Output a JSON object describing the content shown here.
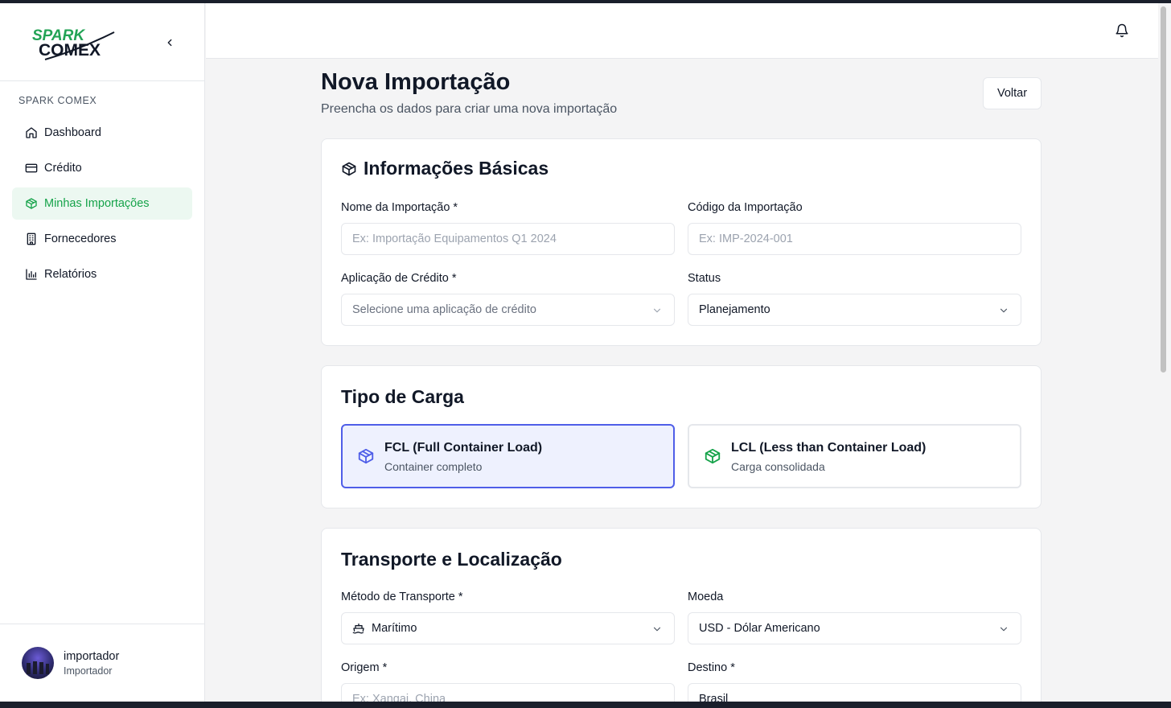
{
  "brand": {
    "logo_top": "SPARK",
    "logo_bottom": "COMEX",
    "accent": "#16a34a"
  },
  "sidebar": {
    "section_label": "SPARK COMEX",
    "items": [
      {
        "label": "Dashboard",
        "icon": "home-icon",
        "active": false
      },
      {
        "label": "Crédito",
        "icon": "credit-card-icon",
        "active": false
      },
      {
        "label": "Minhas Importações",
        "icon": "package-icon",
        "active": true
      },
      {
        "label": "Fornecedores",
        "icon": "building-icon",
        "active": false
      },
      {
        "label": "Relatórios",
        "icon": "bar-chart-icon",
        "active": false
      }
    ],
    "user": {
      "name": "importador",
      "role": "Importador"
    }
  },
  "header": {
    "title": "Nova Importação",
    "subtitle": "Preencha os dados para criar uma nova importação",
    "back_label": "Voltar"
  },
  "basic_info": {
    "title": "Informações Básicas",
    "name_label": "Nome da Importação *",
    "name_placeholder": "Ex: Importação Equipamentos Q1 2024",
    "code_label": "Código da Importação",
    "code_placeholder": "Ex: IMP-2024-001",
    "credit_label": "Aplicação de Crédito *",
    "credit_placeholder": "Selecione uma aplicação de crédito",
    "status_label": "Status",
    "status_value": "Planejamento"
  },
  "cargo": {
    "title": "Tipo de Carga",
    "options": [
      {
        "title": "FCL (Full Container Load)",
        "subtitle": "Container completo",
        "selected": true,
        "color": "#4f5ee8"
      },
      {
        "title": "LCL (Less than Container Load)",
        "subtitle": "Carga consolidada",
        "selected": false,
        "color": "#16a34a"
      }
    ]
  },
  "transport": {
    "title": "Transporte e Localização",
    "method_label": "Método de Transporte *",
    "method_value": "Marítimo",
    "currency_label": "Moeda",
    "currency_value": "USD - Dólar Americano",
    "origin_label": "Origem *",
    "origin_placeholder": "Ex: Xangai, China",
    "destination_label": "Destino *",
    "destination_value": "Brasil"
  }
}
